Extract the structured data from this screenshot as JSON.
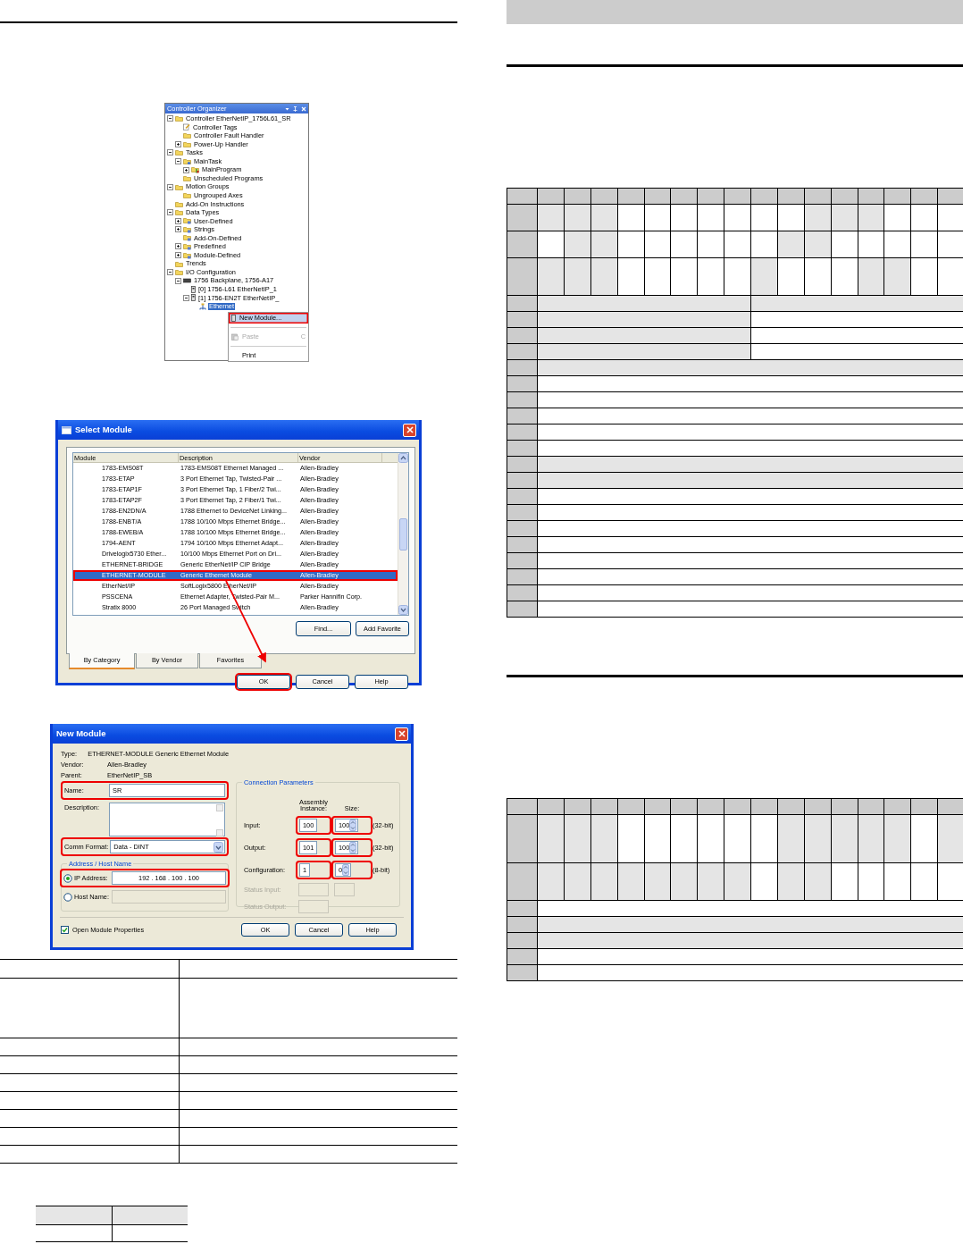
{
  "left_page": {
    "controller_organizer": {
      "title": "Controller Organizer",
      "tree": [
        {
          "label": "Controller EtherNetIP_1756L61_SR",
          "kind": "folder",
          "expanded": true,
          "selected": false,
          "children": [
            {
              "label": "Controller Tags",
              "kind": "tags",
              "selected": false
            },
            {
              "label": "Controller Fault Handler",
              "kind": "folder",
              "selected": false
            },
            {
              "label": "Power-Up Handler",
              "kind": "folder",
              "expanded": false,
              "selected": false
            }
          ]
        },
        {
          "label": "Tasks",
          "kind": "folder",
          "expanded": true,
          "selected": false,
          "children": [
            {
              "label": "MainTask",
              "kind": "task",
              "expanded": true,
              "selected": false,
              "children": [
                {
                  "label": "MainProgram",
                  "kind": "program",
                  "expanded": false,
                  "selected": false
                }
              ]
            },
            {
              "label": "Unscheduled Programs",
              "kind": "folder",
              "selected": false
            }
          ]
        },
        {
          "label": "Motion Groups",
          "kind": "folder",
          "expanded": true,
          "selected": false,
          "children": [
            {
              "label": "Ungrouped Axes",
              "kind": "folder",
              "selected": false
            }
          ]
        },
        {
          "label": "Add-On Instructions",
          "kind": "folder",
          "selected": false
        },
        {
          "label": "Data Types",
          "kind": "folder",
          "expanded": true,
          "selected": false,
          "children": [
            {
              "label": "User-Defined",
              "kind": "datatype",
              "expanded": false,
              "selected": false
            },
            {
              "label": "Strings",
              "kind": "datatype",
              "expanded": false,
              "selected": false
            },
            {
              "label": "Add-On-Defined",
              "kind": "datatype",
              "selected": false
            },
            {
              "label": "Predefined",
              "kind": "datatype",
              "expanded": false,
              "selected": false
            },
            {
              "label": "Module-Defined",
              "kind": "datatype",
              "expanded": false,
              "selected": false
            }
          ]
        },
        {
          "label": "Trends",
          "kind": "folder",
          "selected": false
        },
        {
          "label": "I/O Configuration",
          "kind": "folder",
          "expanded": true,
          "selected": false,
          "children": [
            {
              "label": "1756 Backplane, 1756-A17",
              "kind": "backplane",
              "expanded": true,
              "selected": false,
              "children": [
                {
                  "label": "[0] 1756-L61 EtherNetIP_1",
                  "kind": "module",
                  "selected": false
                },
                {
                  "label": "[1] 1756-EN2T EtherNetIP_",
                  "kind": "module",
                  "expanded": true,
                  "selected": false,
                  "children": [
                    {
                      "label": "Ethernet",
                      "kind": "network",
                      "selected": true
                    }
                  ]
                }
              ]
            }
          ]
        }
      ],
      "context_menu": [
        {
          "label": "New Module...",
          "kind": "module",
          "selected": true,
          "disabled": false,
          "marked": true
        },
        {
          "label": "Paste",
          "shortcut": "C",
          "kind": "paste",
          "selected": false,
          "disabled": true,
          "marked": false
        },
        {
          "label": "Print",
          "kind": "none",
          "selected": false,
          "disabled": false,
          "marked": false
        }
      ]
    },
    "select_module": {
      "title": "Select Module",
      "columns": [
        "Module",
        "Description",
        "Vendor"
      ],
      "rows": [
        {
          "module": "1783-EMS08T",
          "description": "1783-EMS08T Ethernet Managed ...",
          "vendor": "Allen-Bradley",
          "selected": false,
          "marked": false
        },
        {
          "module": "1783-ETAP",
          "description": "3 Port Ethernet Tap, Twisted-Pair ...",
          "vendor": "Allen-Bradley",
          "selected": false,
          "marked": false
        },
        {
          "module": "1783-ETAP1F",
          "description": "3 Port Ethernet Tap, 1 Fiber/2 Twi...",
          "vendor": "Allen-Bradley",
          "selected": false,
          "marked": false
        },
        {
          "module": "1783-ETAP2F",
          "description": "3 Port Ethernet Tap, 2 Fiber/1 Twi...",
          "vendor": "Allen-Bradley",
          "selected": false,
          "marked": false
        },
        {
          "module": "1788-EN2DN/A",
          "description": "1788 Ethernet to DeviceNet Linking...",
          "vendor": "Allen-Bradley",
          "selected": false,
          "marked": false
        },
        {
          "module": "1788-ENBT/A",
          "description": "1788 10/100 Mbps Ethernet Bridge...",
          "vendor": "Allen-Bradley",
          "selected": false,
          "marked": false
        },
        {
          "module": "1788-EWEB/A",
          "description": "1788 10/100 Mbps Ethernet Bridge...",
          "vendor": "Allen-Bradley",
          "selected": false,
          "marked": false
        },
        {
          "module": "1794-AENT",
          "description": "1794 10/100 Mbps Ethernet Adapt...",
          "vendor": "Allen-Bradley",
          "selected": false,
          "marked": false
        },
        {
          "module": "Drivelogix5730 Ether...",
          "description": "10/100 Mbps Ethernet Port on Dri...",
          "vendor": "Allen-Bradley",
          "selected": false,
          "marked": false
        },
        {
          "module": "ETHERNET-BRIDGE",
          "description": "Generic EtherNet/IP CIP Bridge",
          "vendor": "Allen-Bradley",
          "selected": false,
          "marked": false
        },
        {
          "module": "ETHERNET-MODULE",
          "description": "Generic Ethernet Module",
          "vendor": "Allen-Bradley",
          "selected": true,
          "marked": true
        },
        {
          "module": "EtherNet/IP",
          "description": "SoftLogix5800 EtherNet/IP",
          "vendor": "Allen-Bradley",
          "selected": false,
          "marked": false
        },
        {
          "module": "PSSCENA",
          "description": "Ethernet Adapter, Twisted-Pair M...",
          "vendor": "Parker Hannifin Corp.",
          "selected": false,
          "marked": false
        },
        {
          "module": "Stratix 8000",
          "description": "26 Port Managed Switch",
          "vendor": "Allen-Bradley",
          "selected": false,
          "marked": false
        }
      ],
      "list_buttons": [
        {
          "label": "Find...",
          "marked": false
        },
        {
          "label": "Add Favorite",
          "marked": false
        }
      ],
      "tabs": [
        {
          "label": "By Category",
          "selected": true
        },
        {
          "label": "By Vendor",
          "selected": false
        },
        {
          "label": "Favorites",
          "selected": false
        }
      ],
      "buttons": [
        {
          "label": "OK",
          "marked": true
        },
        {
          "label": "Cancel",
          "marked": false
        },
        {
          "label": "Help",
          "marked": false
        }
      ]
    },
    "new_module": {
      "title": "New Module",
      "info": [
        {
          "label": "Type:",
          "value": "ETHERNET-MODULE Generic Ethernet Module"
        },
        {
          "label": "Vendor:",
          "value": "Allen-Bradley"
        },
        {
          "label": "Parent:",
          "value": "EtherNetIP_SB"
        }
      ],
      "name": {
        "label": "Name:",
        "value": "SR",
        "marked": true
      },
      "description": {
        "label": "Description:"
      },
      "comm_format": {
        "label": "Comm Format:",
        "value": "Data - DINT",
        "marked": true
      },
      "address_group": "Address / Host Name",
      "address_options": [
        {
          "label": "IP Address:",
          "value": "192 . 168 . 100 . 100",
          "selected": true,
          "marked": true
        },
        {
          "label": "Host Name:",
          "selected": false,
          "marked": false
        }
      ],
      "connection": {
        "title": "Connection Parameters",
        "instance_heading": "Assembly Instance:",
        "size_heading": "Size:",
        "rows": [
          {
            "kind": "param",
            "label": "Input:",
            "instance": "100",
            "size": "100",
            "unit": "(32-bit)",
            "marked": true
          },
          {
            "kind": "param",
            "label": "Output:",
            "instance": "101",
            "size": "100",
            "unit": "(32-bit)",
            "marked": true
          },
          {
            "kind": "param",
            "label": "Configuration:",
            "instance": "1",
            "size": "0",
            "unit": "(8-bit)",
            "marked": true
          },
          {
            "kind": "status",
            "label": "Status Input:",
            "size_field": true
          },
          {
            "kind": "status",
            "label": "Status Output:",
            "size_field": false
          }
        ]
      },
      "open_properties": {
        "label": "Open Module Properties",
        "checked": true
      },
      "buttons": [
        "OK",
        "Cancel",
        "Help"
      ]
    },
    "table_3": {
      "rows": [
        {
          "shaded": [
            false,
            false
          ]
        },
        {
          "shaded": [
            false,
            false
          ]
        },
        {
          "shaded": [
            false,
            false
          ]
        },
        {
          "shaded": [
            false,
            false
          ]
        },
        {
          "shaded": [
            false,
            false
          ]
        },
        {
          "shaded": [
            false,
            false
          ]
        },
        {
          "shaded": [
            false,
            false
          ]
        },
        {
          "shaded": [
            false,
            false
          ]
        },
        {
          "shaded": [
            false,
            false
          ]
        }
      ]
    },
    "table_4": {
      "rows": [
        {
          "shaded": [
            true,
            true
          ]
        },
        {
          "shaded": [
            false,
            false
          ]
        }
      ]
    }
  },
  "right_page": {
    "table_1": {
      "rows": [
        {
          "kind": "header",
          "shaded": [
            true,
            true,
            true,
            true,
            true,
            true,
            true,
            true,
            true,
            true,
            true,
            true,
            true,
            true,
            true,
            true
          ]
        },
        {
          "kind": "data",
          "shaded": [
            true,
            true,
            true,
            false,
            false,
            false,
            false,
            false,
            false,
            false,
            true,
            true,
            true,
            false,
            false,
            false
          ]
        },
        {
          "kind": "data",
          "shaded": [
            false,
            true,
            true,
            false,
            false,
            false,
            false,
            false,
            false,
            true,
            true,
            false,
            false,
            false,
            false,
            false
          ]
        },
        {
          "kind": "data",
          "shaded": [
            true,
            true,
            true,
            false,
            false,
            false,
            false,
            false,
            true,
            false,
            false,
            false,
            true,
            true,
            false,
            false
          ]
        },
        {
          "kind": "data",
          "shaded": [
            true,
            true
          ]
        },
        {
          "kind": "data",
          "shaded": [
            true,
            false
          ]
        },
        {
          "kind": "data",
          "shaded": [
            true,
            false
          ]
        },
        {
          "kind": "data",
          "shaded": [
            true,
            false
          ]
        },
        {
          "kind": "data",
          "shaded": [
            true
          ]
        },
        {
          "kind": "data",
          "shaded": [
            false
          ]
        },
        {
          "kind": "data",
          "shaded": [
            false
          ]
        },
        {
          "kind": "data",
          "shaded": [
            false
          ]
        },
        {
          "kind": "data",
          "shaded": [
            false
          ]
        },
        {
          "kind": "data",
          "shaded": [
            false
          ]
        },
        {
          "kind": "data",
          "shaded": [
            true
          ]
        },
        {
          "kind": "data",
          "shaded": [
            true
          ]
        },
        {
          "kind": "data",
          "shaded": [
            false
          ]
        },
        {
          "kind": "data",
          "shaded": [
            false
          ]
        },
        {
          "kind": "data",
          "shaded": [
            false
          ]
        },
        {
          "kind": "data",
          "shaded": [
            false
          ]
        },
        {
          "kind": "data",
          "shaded": [
            false
          ]
        },
        {
          "kind": "data",
          "shaded": [
            false
          ]
        },
        {
          "kind": "data",
          "shaded": [
            false
          ]
        },
        {
          "kind": "data",
          "shaded": [
            false
          ]
        }
      ]
    },
    "table_2": {
      "rows": [
        {
          "kind": "header",
          "shaded": [
            true,
            true,
            true,
            true,
            true,
            true,
            true,
            true,
            true,
            true,
            true,
            true,
            true,
            true,
            true,
            true
          ]
        },
        {
          "kind": "data",
          "shaded": [
            true,
            true,
            true,
            false,
            false,
            false,
            false,
            false,
            false,
            true,
            true,
            true,
            true,
            true,
            false,
            true
          ]
        },
        {
          "kind": "data",
          "shaded": [
            true,
            true,
            true,
            true,
            true,
            true,
            true,
            true,
            false,
            true,
            true,
            false,
            false,
            false,
            false,
            false
          ]
        },
        {
          "kind": "data",
          "shaded": [
            false
          ]
        },
        {
          "kind": "data",
          "shaded": [
            true
          ]
        },
        {
          "kind": "data",
          "shaded": [
            true
          ]
        },
        {
          "kind": "data",
          "shaded": [
            false
          ]
        },
        {
          "kind": "data",
          "shaded": [
            false
          ]
        }
      ]
    }
  }
}
